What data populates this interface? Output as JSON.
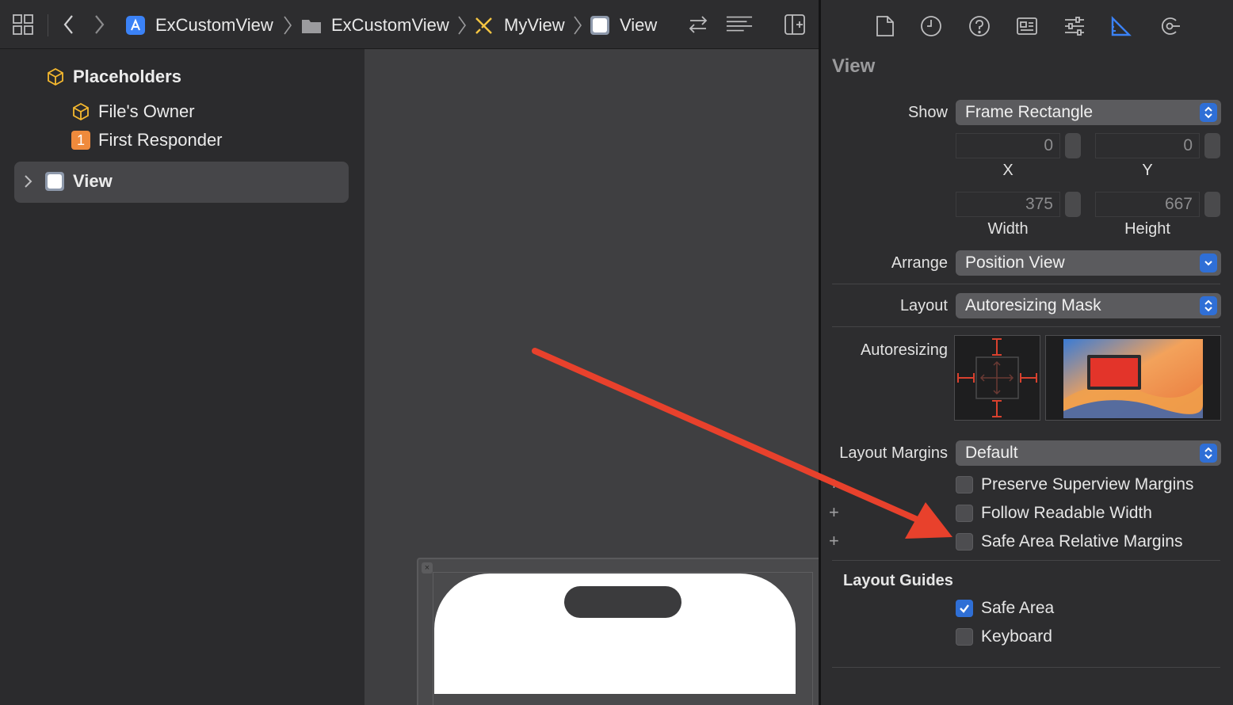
{
  "topbar": {
    "breadcrumbs": [
      {
        "label": "ExCustomView",
        "icon": "app-icon"
      },
      {
        "label": "ExCustomView",
        "icon": "folder-icon"
      },
      {
        "label": "MyView",
        "icon": "xib-icon"
      },
      {
        "label": "View",
        "icon": "view-icon"
      }
    ]
  },
  "outline": {
    "placeholders_label": "Placeholders",
    "files_owner_label": "File's Owner",
    "first_responder_badge": "1",
    "first_responder_label": "First Responder",
    "view_label": "View"
  },
  "canvas": {
    "close_glyph": "×"
  },
  "inspector": {
    "title": "View",
    "show_label": "Show",
    "show_value": "Frame Rectangle",
    "x_value": "0",
    "x_label": "X",
    "y_value": "0",
    "y_label": "Y",
    "width_value": "375",
    "width_label": "Width",
    "height_value": "667",
    "height_label": "Height",
    "arrange_label": "Arrange",
    "arrange_value": "Position View",
    "layout_label": "Layout",
    "layout_value": "Autoresizing Mask",
    "autoresizing_label": "Autoresizing",
    "layout_margins_label": "Layout Margins",
    "layout_margins_value": "Default",
    "checkboxes": [
      {
        "label": "Preserve Superview Margins",
        "checked": false
      },
      {
        "label": "Follow Readable Width",
        "checked": false
      },
      {
        "label": "Safe Area Relative Margins",
        "checked": false
      }
    ],
    "layout_guides_title": "Layout Guides",
    "guides": [
      {
        "label": "Safe Area",
        "checked": true
      },
      {
        "label": "Keyboard",
        "checked": false
      }
    ]
  },
  "colors": {
    "accent": "#2f6fd6",
    "annotation_arrow": "#e8412c",
    "autoresize_strut": "#d9412e"
  }
}
